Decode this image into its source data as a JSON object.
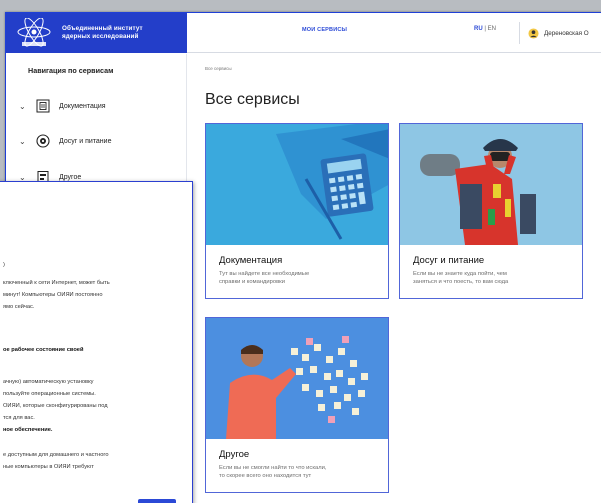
{
  "header": {
    "logo_line1": "Объединенный институт",
    "logo_line2": "ядерных исследований",
    "nav_link": "МОИ СЕРВИСЫ",
    "lang_ru": "RU",
    "lang_sep": " | ",
    "lang_en": "EN",
    "user_name": "Дереновская О"
  },
  "sidebar": {
    "title": "Навигация по сервисам",
    "items": [
      {
        "label": "Документация",
        "icon": "document-icon"
      },
      {
        "label": "Досуг и питание",
        "icon": "leisure-icon"
      },
      {
        "label": "Другое",
        "icon": "other-icon"
      }
    ]
  },
  "main": {
    "breadcrumb": "Все сервисы",
    "heading": "Все сервисы",
    "cards": [
      {
        "title": "Документация",
        "desc1": "Тут вы найдете все необходимые",
        "desc2": "справки и командировки"
      },
      {
        "title": "Досуг и питание",
        "desc1": "Если вы не знаете куда пойти, чем",
        "desc2": "заняться и что поесть, то вам сюда"
      },
      {
        "title": "Другое",
        "desc1": "Если вы не смогли найти то что искали,",
        "desc2": "то скорее всего оно находится тут"
      }
    ]
  },
  "dialog": {
    "lines": [
      {
        "text": ")",
        "bold": false
      },
      {
        "text": "ключенный к сети Интернет, может быть",
        "bold": false
      },
      {
        "text": "минут! Компьютеры ОИЯИ постоянно",
        "bold": false
      },
      {
        "text": "ямо сейчас.",
        "bold": false
      },
      {
        "text": "ое рабочее состояние своей",
        "bold": true
      },
      {
        "text": "ачную) автоматическую установку",
        "bold": false
      },
      {
        "text": "пользуйте операционные системы.",
        "bold": false
      },
      {
        "text": "ОИЯИ, которые сконфигурированы под",
        "bold": false
      },
      {
        "text": "тся для вас.",
        "bold": false
      },
      {
        "text": "ное обеспечение.",
        "bold": true
      },
      {
        "text": "е доступным для домашнего и частного",
        "bold": false
      },
      {
        "text": "ные компьютеры в ОИЯИ требуют",
        "bold": false
      }
    ]
  },
  "colors": {
    "brand_blue": "#233ec9",
    "link_blue": "#2a49d6"
  }
}
